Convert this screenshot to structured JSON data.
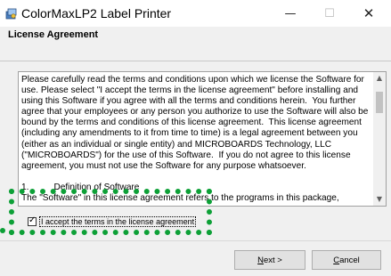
{
  "window": {
    "title": "ColorMaxLP2 Label Printer",
    "minimize_glyph": "—",
    "maximize_glyph": "☐",
    "close_glyph": "✕"
  },
  "header": {
    "page_title": "License Agreement"
  },
  "license": {
    "text": "Please carefully read the terms and conditions upon which we license the Software for use. Please select \"I accept the terms in the license agreement\" before installing and using this Software if you agree with all the terms and conditions herein.  You further agree that your employees or any person you authorize to use the Software will also be bound by the terms and conditions of this license agreement.  This license agreement (including any amendments to it from time to time) is a legal agreement between you (either as an individual or single entity) and MICROBOARDS Technology, LLC (\"MICROBOARDS\") for the use of this Software.  If you do not agree to this license agreement, you must not use the Software for any purpose whatsoever.\n\n1.          Definition of Software\nThe \"Software\" in this license agreement refers to the programs in this package,"
  },
  "scrollbar": {
    "up_glyph": "▲",
    "down_glyph": "▼"
  },
  "accept": {
    "label": "I accept the terms in the license agreement",
    "checked": true,
    "check_glyph": "✓"
  },
  "buttons": {
    "next_accel": "N",
    "next_rest": "ext >",
    "cancel_accel": "C",
    "cancel_rest": "ancel"
  },
  "colors": {
    "highlight": "#0da037"
  }
}
